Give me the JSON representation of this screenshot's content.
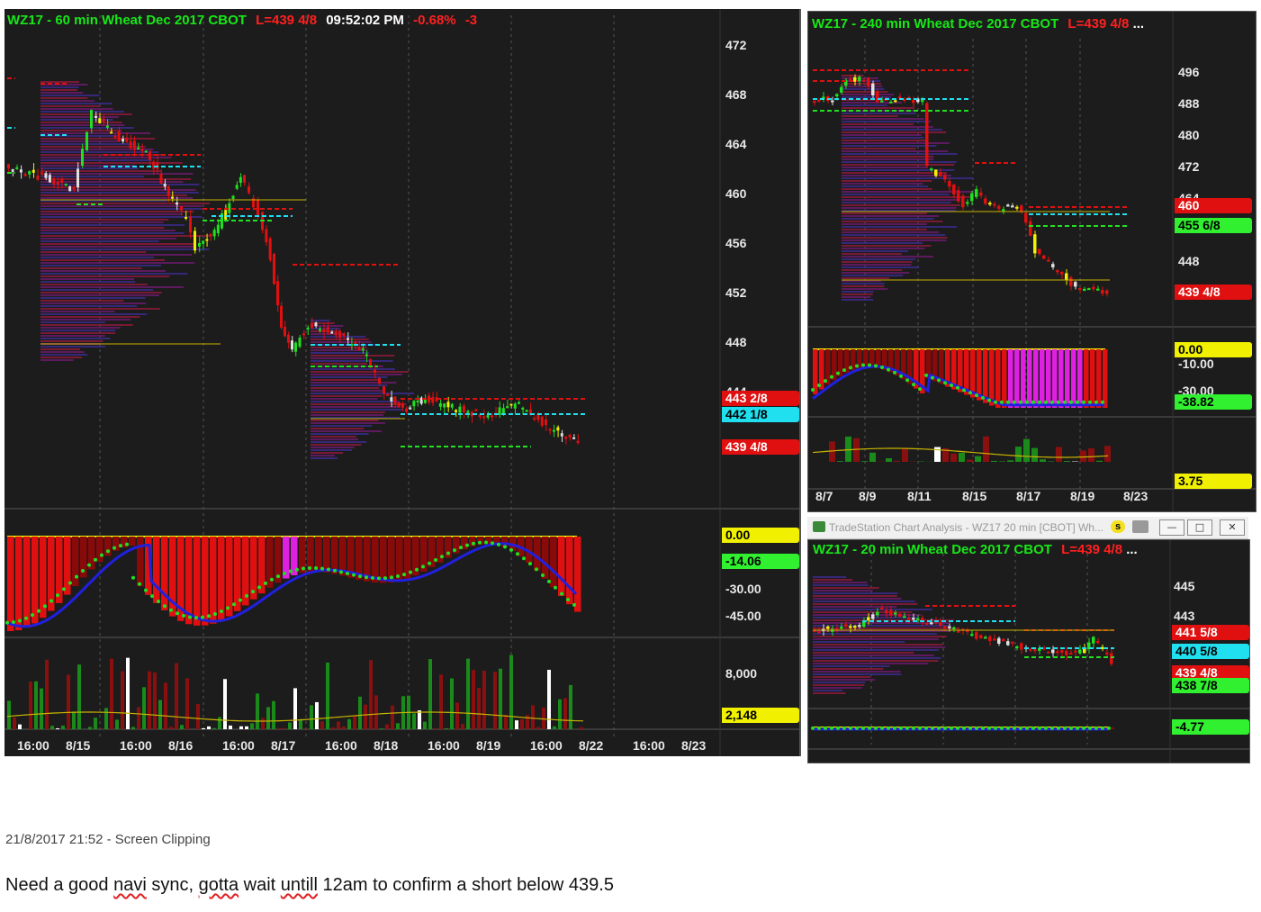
{
  "chart_data": [
    {
      "type": "candlestick",
      "title": "WZ17 - 60 min  Wheat Dec 2017  CBOT",
      "price_axis_ticks": [
        472,
        468,
        464,
        460,
        456,
        452,
        448,
        444
      ],
      "ylim": [
        443,
        473
      ],
      "x_ticks": [
        "16:00",
        "8/15",
        "16:00",
        "8/16",
        "16:00",
        "8/17",
        "16:00",
        "8/18",
        "16:00",
        "8/19",
        "16:00",
        "8/22",
        "16:00",
        "8/23"
      ],
      "price_tags": [
        {
          "label": "443 2/8",
          "color": "#e01010"
        },
        {
          "label": "442 1/8",
          "color": "#20e0f0"
        },
        {
          "label": "439 4/8",
          "color": "#e01010"
        }
      ],
      "indicator_ticks": [
        "-30.00",
        "-45.00"
      ],
      "indicator_tags": [
        {
          "label": "0.00",
          "color": "#f0f000"
        },
        {
          "label": "-14.06",
          "color": "#30f030"
        }
      ],
      "volume_ticks": [
        "8,000"
      ],
      "volume_tags": [
        {
          "label": "2,148",
          "color": "#f0f000"
        }
      ]
    },
    {
      "type": "candlestick",
      "title": "WZ17 - 240 min  Wheat Dec 2017  CBOT",
      "price_axis_ticks": [
        496,
        488,
        480,
        472,
        464,
        448
      ],
      "ylim": [
        436,
        500
      ],
      "x_ticks": [
        "8/7",
        "8/9",
        "8/11",
        "8/15",
        "8/17",
        "8/19",
        "8/23"
      ],
      "price_tags": [
        {
          "label": "460",
          "color": "#e01010"
        },
        {
          "label": "455 6/8",
          "color": "#30f030"
        },
        {
          "label": "439 4/8",
          "color": "#e01010"
        }
      ],
      "indicator_ticks": [
        "-10.00",
        "-30.00"
      ],
      "indicator_tags": [
        {
          "label": "0.00",
          "color": "#f0f000"
        },
        {
          "label": "-38.82",
          "color": "#30f030"
        }
      ],
      "volume_tags": [
        {
          "label": "3.75",
          "color": "#f0f000"
        }
      ]
    },
    {
      "type": "candlestick",
      "title": "WZ17 - 20 min  Wheat Dec 2017  CBOT",
      "price_axis_ticks": [
        445,
        443
      ],
      "ylim": [
        437,
        446
      ],
      "price_tags": [
        {
          "label": "441 5/8",
          "color": "#e01010"
        },
        {
          "label": "440 5/8",
          "color": "#20e0f0"
        },
        {
          "label": "439 4/8",
          "color": "#e01010"
        },
        {
          "label": "438 7/8",
          "color": "#30f030"
        }
      ],
      "indicator_tags": [
        {
          "label": "-4.77",
          "color": "#30f030"
        }
      ]
    }
  ],
  "main": {
    "symbol": "WZ17 - 60 min  Wheat Dec 2017  CBOT",
    "last": "L=439 4/8",
    "time": "09:52:02 PM",
    "change_pct": "-0.68%",
    "change": "-3"
  },
  "tr": {
    "symbol": "WZ17 - 240 min  Wheat Dec 2017  CBOT",
    "last": "L=439 4/8",
    "more": "..."
  },
  "br": {
    "window_title": "TradeStation Chart Analysis - WZ17 20 min [CBOT] Wh...",
    "symbol": "WZ17 - 20 min  Wheat Dec 2017  CBOT",
    "last": "L=439 4/8",
    "more": "...",
    "btn_s": "s",
    "btn_min": "—",
    "btn_max": "□",
    "btn_close": "✕"
  },
  "caption": "21/8/2017 21:52 - Screen Clipping",
  "note": {
    "p1": "Need a good ",
    "w1": "navi",
    "p2": " sync, ",
    "w2": "gotta",
    "p3": " wait ",
    "w3": "untill",
    "p4": " 12am to confirm a short below 439.5"
  }
}
